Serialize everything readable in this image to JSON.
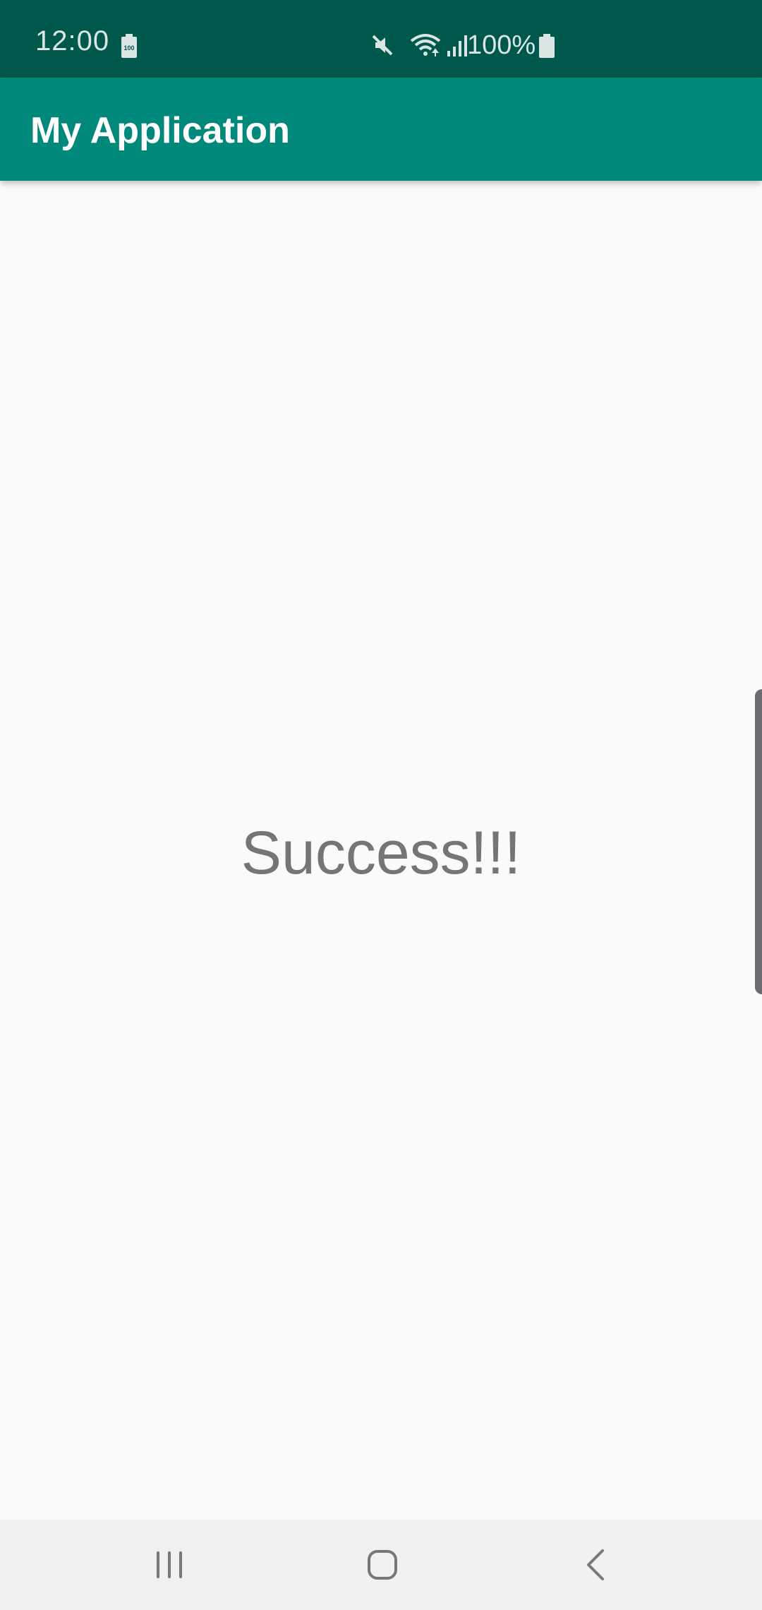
{
  "status_bar": {
    "time": "12:00",
    "battery_percent": "100%",
    "icons": [
      "battery-saver-icon",
      "mute-icon",
      "wifi-icon",
      "signal-icon",
      "battery-icon"
    ],
    "background_color": "#00574b"
  },
  "app_bar": {
    "title": "My Application",
    "background_color": "#00897b"
  },
  "main": {
    "message": "Success!!!"
  },
  "nav_bar": {
    "buttons": [
      "recents-icon",
      "home-icon",
      "back-icon"
    ]
  }
}
